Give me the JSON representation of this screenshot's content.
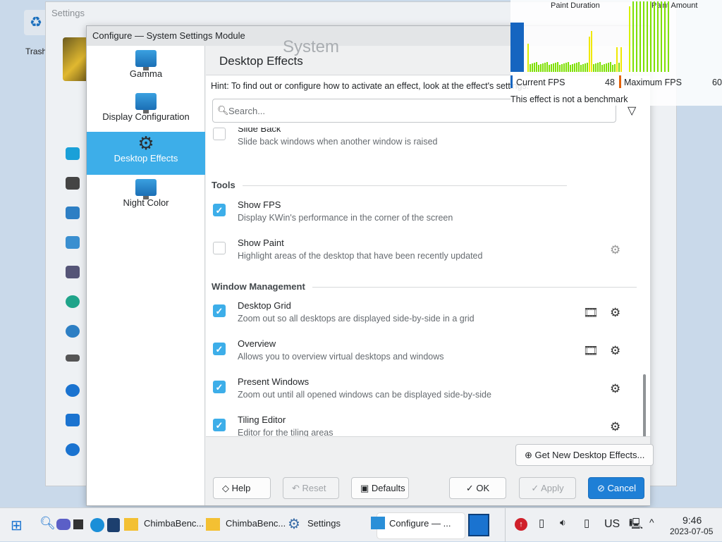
{
  "desktop": {
    "trash_label": "Trash"
  },
  "settings_window": {
    "title": "Settings",
    "heading": "System"
  },
  "dialog": {
    "title": "Configure — System Settings Module",
    "sidebar": [
      {
        "label": "Gamma"
      },
      {
        "label": "Display Configuration"
      },
      {
        "label": "Desktop Effects",
        "selected": true
      },
      {
        "label": "Night Color"
      }
    ],
    "page_title": "Desktop Effects",
    "hint": "Hint: To find out or configure how to activate an effect, look at the effect's settings.",
    "search_placeholder": "Search...",
    "sections": [
      {
        "title": "",
        "items": [
          {
            "name": "Slide Back",
            "desc": "Slide back windows when another window is raised",
            "checked": false
          }
        ]
      },
      {
        "title": "Tools",
        "items": [
          {
            "name": "Show FPS",
            "desc": "Display KWin's performance in the corner of the screen",
            "checked": true
          },
          {
            "name": "Show Paint",
            "desc": "Highlight areas of the desktop that have been recently updated",
            "checked": false
          }
        ]
      },
      {
        "title": "Window Management",
        "items": [
          {
            "name": "Desktop Grid",
            "desc": "Zoom out so all desktops are displayed side-by-side in a grid",
            "checked": true
          },
          {
            "name": "Overview",
            "desc": "Allows you to overview virtual desktops and windows",
            "checked": true
          },
          {
            "name": "Present Windows",
            "desc": "Zoom out until all opened windows can be displayed side-by-side",
            "checked": true
          },
          {
            "name": "Tiling Editor",
            "desc": "Editor for the tiling areas",
            "checked": true
          }
        ]
      }
    ],
    "get_new": "Get New Desktop Effects...",
    "buttons": {
      "help": "Help",
      "reset": "Reset",
      "defaults": "Defaults",
      "ok": "OK",
      "apply": "Apply",
      "cancel": "Cancel"
    }
  },
  "fps_overlay": {
    "paint_duration": "Paint Duration",
    "paint_amount": "Paint Amount",
    "current_fps_label": "Current FPS",
    "current_fps": "48",
    "max_fps_label": "Maximum FPS",
    "max_fps": "60",
    "note": "This effect is not a benchmark",
    "fps_fraction": 0.8
  },
  "taskbar": {
    "items": [
      "ChimbaBenc...",
      "ChimbaBenc...",
      "Settings",
      "Configure — ..."
    ],
    "lang": "US",
    "time": "9:46",
    "date": "2023-07-05"
  },
  "colors": {
    "accent": "#3daee9",
    "primary_button": "#1e7fd6"
  }
}
